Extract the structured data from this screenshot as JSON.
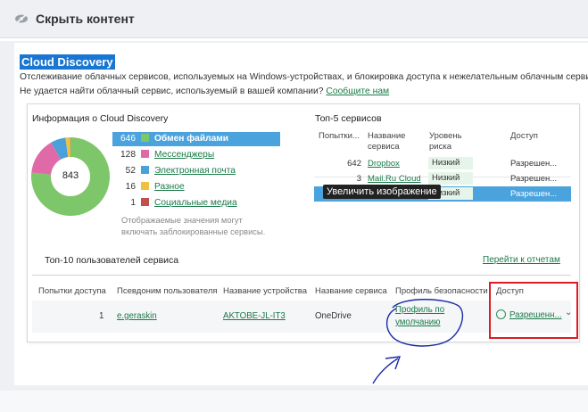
{
  "header": {
    "title": "Скрыть контент",
    "icon": "eye-slash-icon"
  },
  "section": {
    "title": "Cloud Discovery",
    "description": "Отслеживание облачных сервисов, используемых на Windows-устройствах, и блокировка доступа к нежелательным облачным сервисам.",
    "question": "Не удается найти облачный сервис, используемый в вашей компании?",
    "report_link": "Сообщите нам"
  },
  "info": {
    "title": "Информация о Cloud Discovery",
    "total": "843",
    "categories": [
      {
        "count": "646",
        "label": "Обмен файлами",
        "color": "#7dc66a",
        "active": true
      },
      {
        "count": "128",
        "label": "Мессенджеры",
        "color": "#e06aa8",
        "active": false
      },
      {
        "count": "52",
        "label": "Электронная почта",
        "color": "#4aa0d8",
        "active": false
      },
      {
        "count": "16",
        "label": "Разное",
        "color": "#f0c040",
        "active": false
      },
      {
        "count": "1",
        "label": "Социальные медиа",
        "color": "#c0504d",
        "active": false
      }
    ],
    "note_line1": "Отображаемые значения могут",
    "note_line2": "включать заблокированные сервисы."
  },
  "top5": {
    "title": "Топ-5 сервисов",
    "headers": {
      "attempts": "Попытки...",
      "name_l1": "Название",
      "name_l2": "сервиса",
      "risk_l1": "Уровень",
      "risk_l2": "риска",
      "access": "Доступ"
    },
    "rows": [
      {
        "attempts": "642",
        "name": "Dropbox",
        "risk": "Низкий",
        "access": "Разрешен..."
      },
      {
        "attempts": "3",
        "name": "Mail.Ru Cloud",
        "risk": "Низкий",
        "access": "Разрешен..."
      },
      {
        "attempts": "",
        "name": "",
        "risk": "Низкий",
        "access": "Разрешен..."
      }
    ],
    "tooltip": "Увеличить изображение"
  },
  "top10": {
    "title": "Топ-10 пользователей сервиса",
    "link": "Перейти к отчетам",
    "headers": {
      "attempts": "Попытки доступа",
      "alias": "Псевдоним пользователя",
      "device": "Название устройства",
      "service": "Название сервиса",
      "profile": "Профиль безопасности",
      "access": "Доступ"
    },
    "row": {
      "attempts": "1",
      "alias": "e.geraskin",
      "device": "AKTOBE-JL-IT3",
      "service": "OneDrive",
      "profile_l1": "Профиль по",
      "profile_l2": "умолчанию",
      "access": "Разрешенн..."
    }
  },
  "colors": {
    "accent_blue": "#4ba3dd",
    "link_green": "#1a7a48",
    "annotation_red": "#e01b24",
    "annotation_ink": "#1a2aa8"
  }
}
